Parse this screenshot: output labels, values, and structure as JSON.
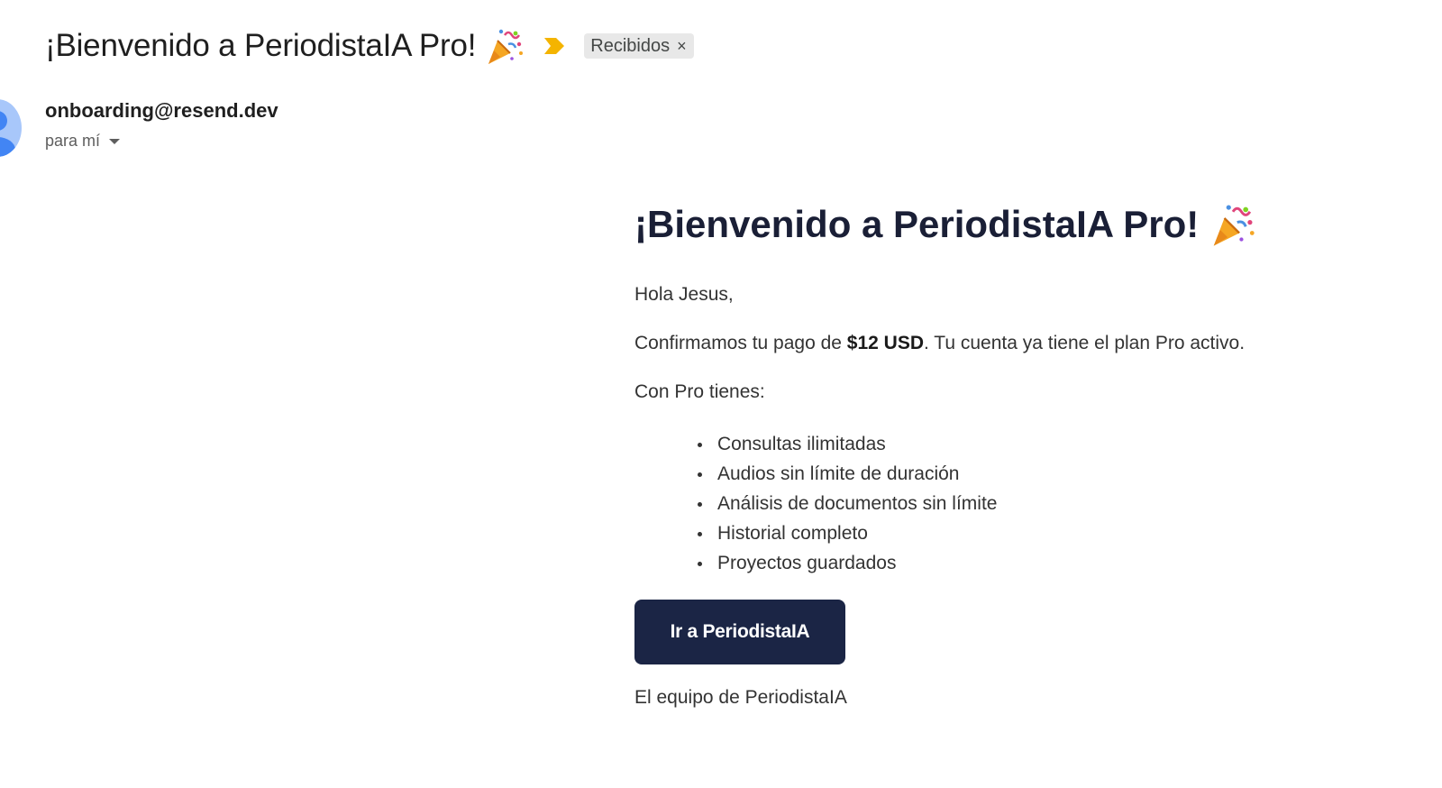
{
  "subject": {
    "title": "¡Bienvenido a PeriodistaIA Pro!",
    "title_icon": "party-popper-icon",
    "importance_icon": "importance-marker-icon",
    "label": "Recibidos",
    "label_remove": "×"
  },
  "sender": {
    "email": "onboarding@resend.dev",
    "recipient_text": "para mí",
    "avatar_icon": "person-avatar-icon"
  },
  "body": {
    "heading": "¡Bienvenido a PeriodistaIA Pro!",
    "greeting": "Hola Jesus,",
    "confirm_prefix": "Confirmamos tu pago de ",
    "confirm_amount": "$12 USD",
    "confirm_suffix": ". Tu cuenta ya tiene el plan Pro activo.",
    "features_intro": "Con Pro tienes:",
    "features": [
      "Consultas ilimitadas",
      "Audios sin límite de duración",
      "Análisis de documentos sin límite",
      "Historial completo",
      "Proyectos guardados"
    ],
    "cta_label": "Ir a PeriodistaIA",
    "signoff": "El equipo de PeriodistaIA"
  },
  "colors": {
    "cta_background": "#1b2545",
    "importance": "#f4b400",
    "label_chip": "#e8e8e8",
    "avatar": "#a8c7fa"
  }
}
